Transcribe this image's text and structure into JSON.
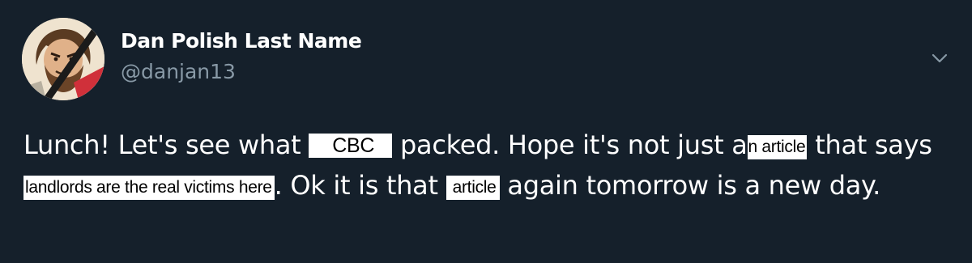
{
  "user": {
    "display_name": "Dan Polish Last Name",
    "handle": "@danjan13"
  },
  "tweet": {
    "text_1": "Lunch! Let's see what ",
    "redact_1": "CBC",
    "text_2": " packed. Hope it's not just a",
    "redact_2": "n article",
    "text_3": " that says ",
    "redact_3": "landlords are the real victims here",
    "text_4": ". Ok it is that ",
    "redact_4": "article",
    "text_5": " again tomorrow is a new day."
  },
  "icons": {
    "avatar": "avatar-image",
    "menu": "chevron-down-icon"
  },
  "colors": {
    "background": "#15202b",
    "secondary_text": "#8899a6",
    "redaction_box": "#ffffff"
  }
}
